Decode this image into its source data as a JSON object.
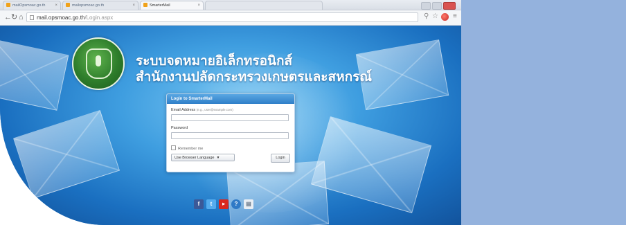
{
  "browser": {
    "tabs": [
      {
        "label": "mailOpsmoac.go.th"
      },
      {
        "label": "mailopsmoac.go.th"
      },
      {
        "label": "SmarterMail"
      },
      {
        "label": ""
      }
    ],
    "address": {
      "host": "mail.opsmoac.go.th",
      "path": "/Login.aspx"
    }
  },
  "header": {
    "line1": "ระบบจดหมายอิเล็กทรอนิกส์",
    "line2": "สำนักงานปลัดกระทรวงเกษตรและสหกรณ์"
  },
  "login": {
    "title": "Login to SmarterMail",
    "email_label": "Email Address",
    "email_hint": "(e.g., user@example.com)",
    "password_label": "Password",
    "remember_label": "Remember me",
    "language": "Use Browser Language",
    "submit": "Login"
  },
  "colors": {
    "page_blue": "#3f9ee0",
    "right_panel": "#94b2dd"
  },
  "social_icons": [
    "facebook-icon",
    "twitter-icon",
    "youtube-icon",
    "help-icon",
    "document-icon"
  ]
}
